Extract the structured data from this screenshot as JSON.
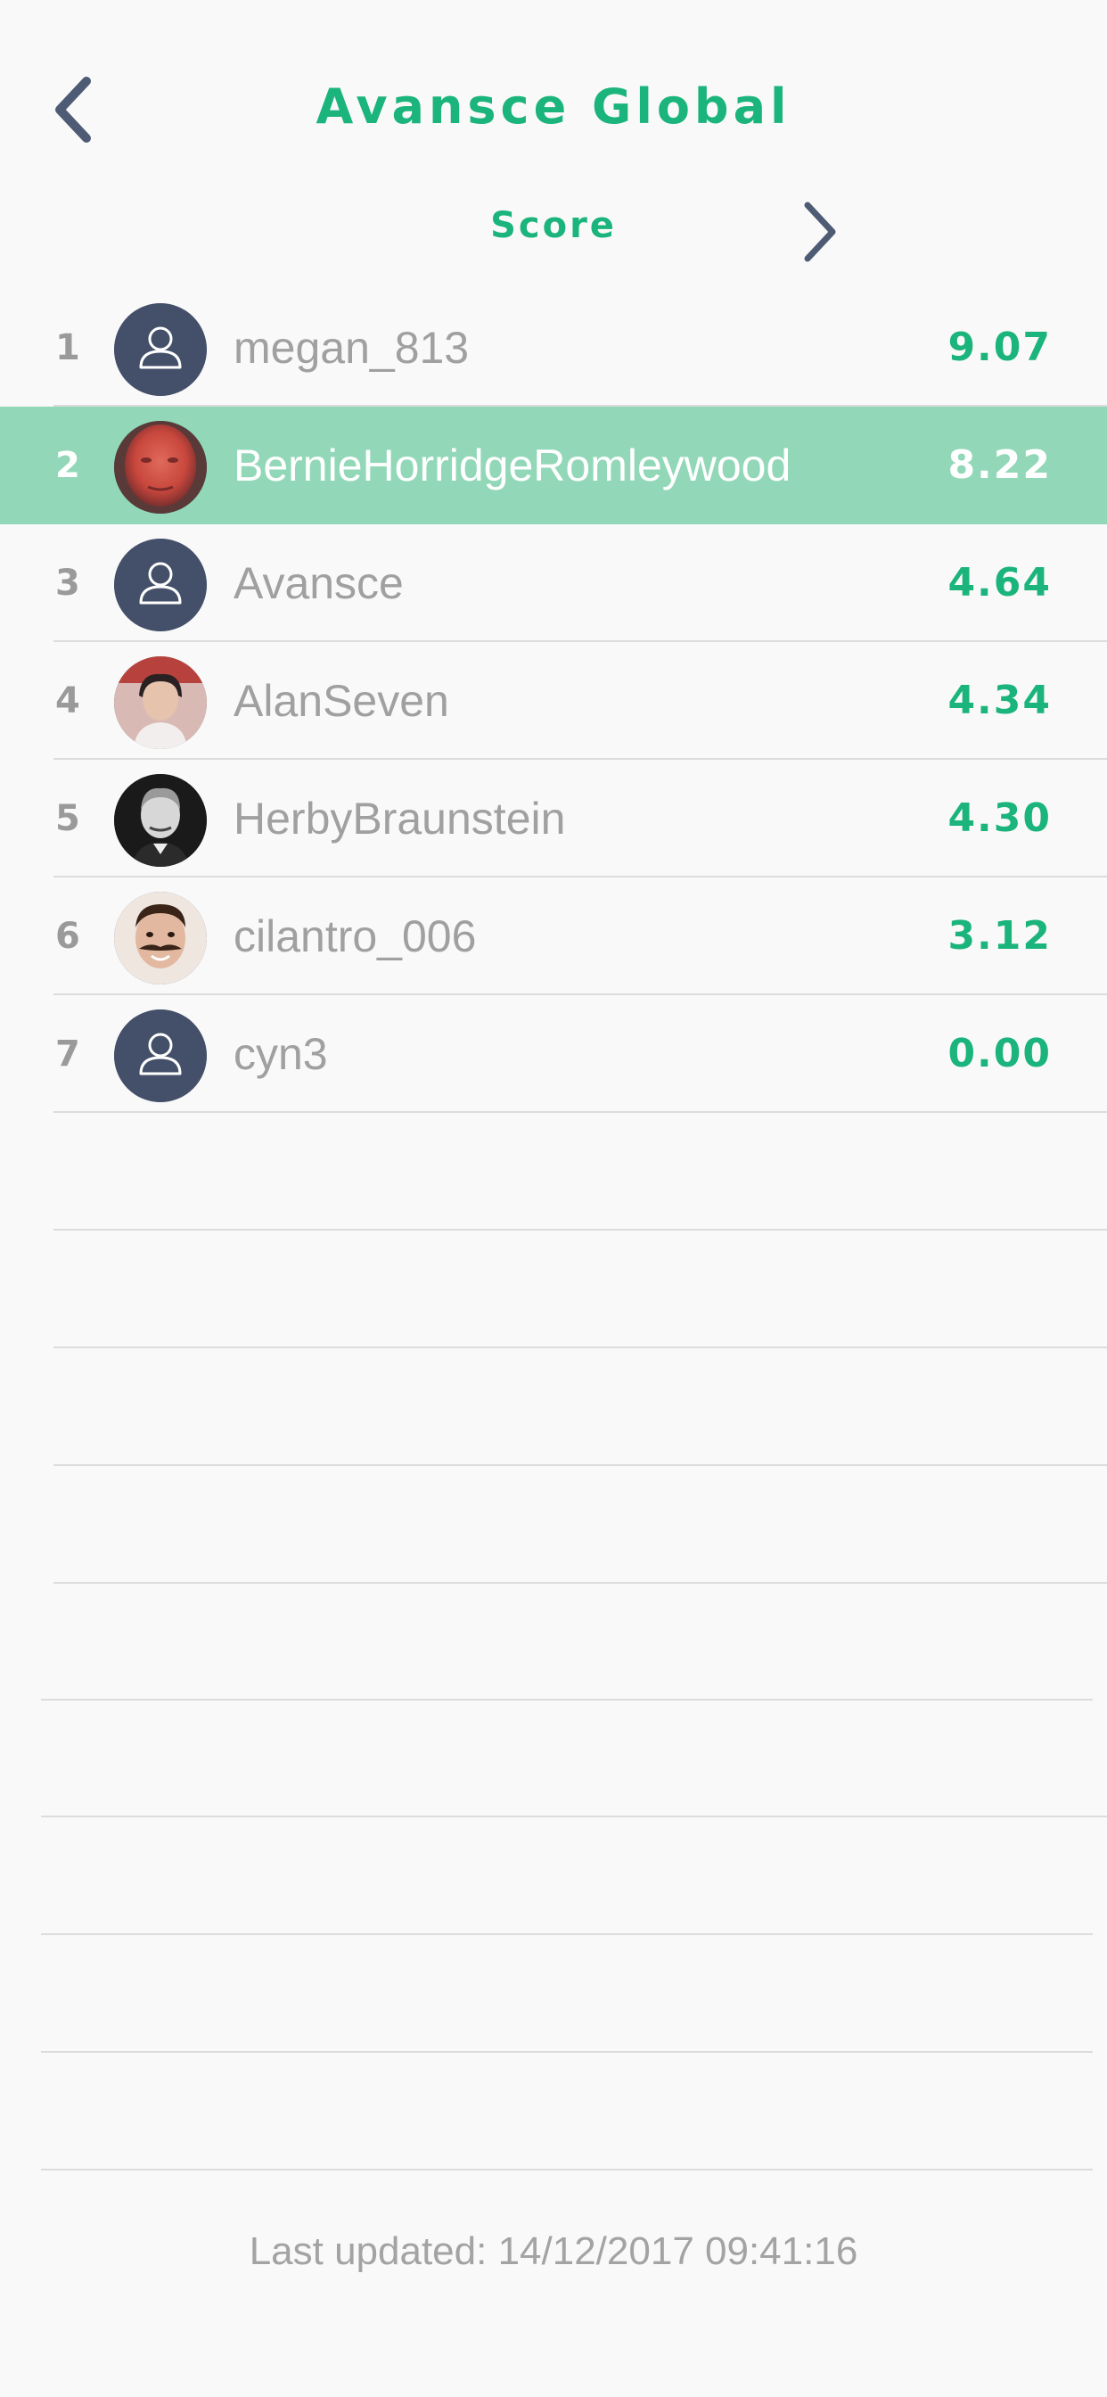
{
  "header": {
    "title": "Avansce Global",
    "metric_label": "Score",
    "back_icon": "chevron-left-icon",
    "next_icon": "chevron-right-icon"
  },
  "colors": {
    "accent": "#1bb47c",
    "highlight_row": "#92d8b8",
    "default_avatar": "#44506a",
    "muted_text": "#9a9a9a"
  },
  "leaderboard": [
    {
      "rank": "1",
      "username": "megan_813",
      "score": "9.07",
      "avatar": "default-user-icon"
    },
    {
      "rank": "2",
      "username": "BernieHorridgeRomleywood",
      "score": "8.22",
      "avatar": "photo"
    },
    {
      "rank": "3",
      "username": "Avansce",
      "score": "4.64",
      "avatar": "default-user-icon"
    },
    {
      "rank": "4",
      "username": "AlanSeven",
      "score": "4.34",
      "avatar": "photo"
    },
    {
      "rank": "5",
      "username": "HerbyBraunstein",
      "score": "4.30",
      "avatar": "photo"
    },
    {
      "rank": "6",
      "username": "cilantro_006",
      "score": "3.12",
      "avatar": "photo"
    },
    {
      "rank": "7",
      "username": "cyn3",
      "score": "0.00",
      "avatar": "default-user-icon"
    }
  ],
  "footer": {
    "last_updated": "Last updated: 14/12/2017 09:41:16"
  }
}
